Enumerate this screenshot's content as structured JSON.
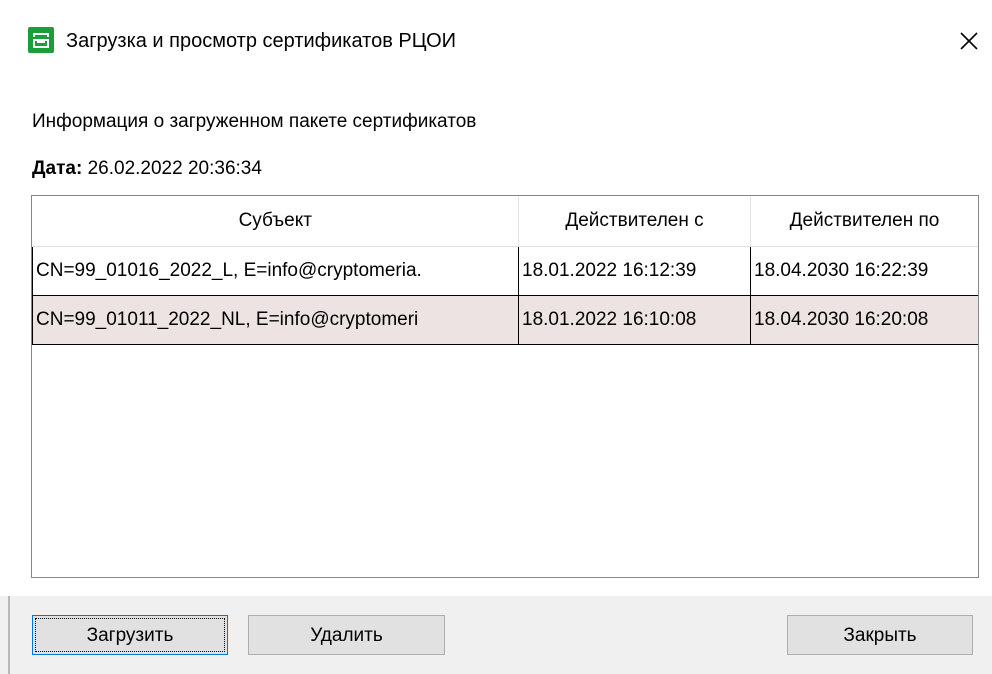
{
  "window": {
    "title": "Загрузка и просмотр сертификатов РЦОИ",
    "icon": "archive-box-icon",
    "close_icon": "close-icon"
  },
  "info": {
    "heading": "Информация о загруженном пакете сертификатов",
    "date_label": "Дата:",
    "date_value": "26.02.2022 20:36:34"
  },
  "table": {
    "columns": [
      "Субъект",
      "Действителен с",
      "Действителен по"
    ],
    "rows": [
      {
        "subject": "CN=99_01016_2022_L, E=info@cryptomeria.",
        "valid_from": "18.01.2022 16:12:39",
        "valid_to": "18.04.2030 16:22:39"
      },
      {
        "subject": "CN=99_01011_2022_NL, E=info@cryptomeri",
        "valid_from": "18.01.2022 16:10:08",
        "valid_to": "18.04.2030 16:20:08"
      }
    ]
  },
  "buttons": {
    "load": "Загрузить",
    "delete": "Удалить",
    "close": "Закрыть"
  },
  "colors": {
    "icon_green": "#1a9e3a",
    "selected_row": "#ede3e3",
    "button_bar": "#f0f0f0",
    "focus_border": "#0078d7"
  }
}
